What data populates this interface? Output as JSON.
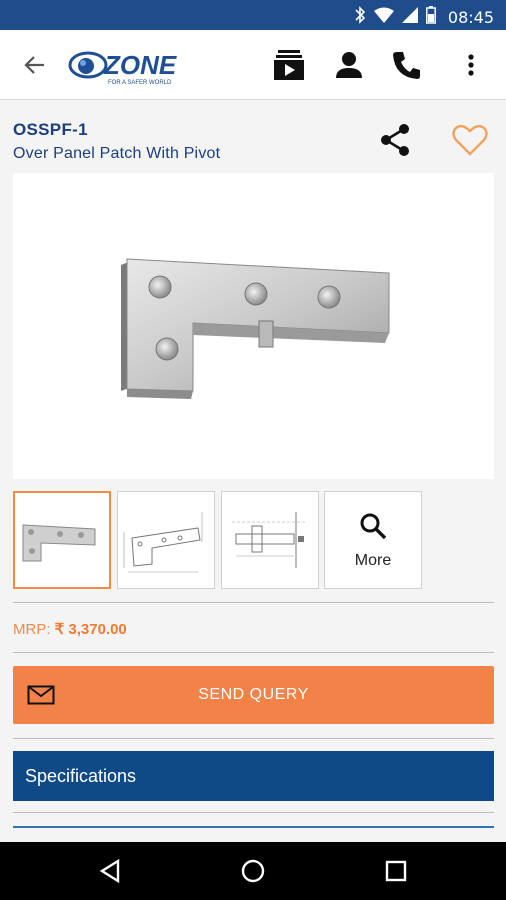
{
  "status_bar": {
    "time": "08:45",
    "icons": [
      "bluetooth-icon",
      "wifi-icon",
      "signal-icon",
      "battery-icon"
    ]
  },
  "app_bar": {
    "back_icon": "arrow-left-icon",
    "logo_text": "OZONE",
    "logo_tagline": "FOR A SAFER WORLD",
    "actions": [
      "video-catalog-icon",
      "account-icon",
      "phone-icon",
      "more-vert-icon"
    ]
  },
  "product": {
    "code": "OSSPF-1",
    "name": "Over Panel Patch With Pivot",
    "share_icon": "share-icon",
    "favorite_icon": "heart-outline-icon"
  },
  "gallery": {
    "more_label": "More",
    "more_icon": "search-icon"
  },
  "price": {
    "label": "MRP:",
    "value": "₹ 3,370.00"
  },
  "send_query": {
    "label": "SEND QUERY",
    "icon": "mail-icon"
  },
  "specifications": {
    "label": "Specifications"
  },
  "nav_bar": {
    "buttons": [
      "back-triangle-icon",
      "home-circle-icon",
      "recents-square-icon"
    ]
  },
  "colors": {
    "brand_blue": "#1f4c8a",
    "accent_orange": "#f28247",
    "spec_blue": "#0f4a86"
  }
}
